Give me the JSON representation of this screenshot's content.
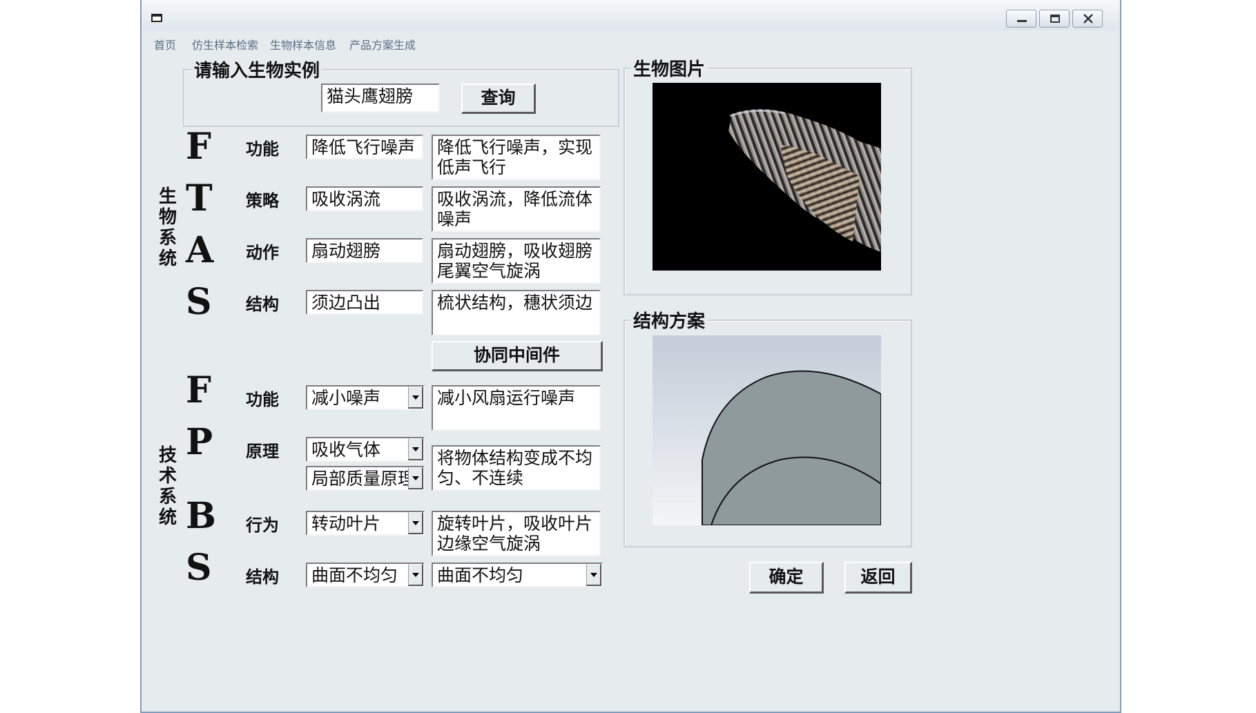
{
  "menu": {
    "items": [
      "首页",
      "仿生样本检索",
      "生物样本信息",
      "产品方案生成"
    ]
  },
  "search": {
    "legend": "请输入生物实例",
    "value": "猫头鹰翅膀",
    "button_label": "查询"
  },
  "bio": {
    "side_label": "生物系统",
    "rows": [
      {
        "letter": "F",
        "label": "功能",
        "value": "降低飞行噪声",
        "desc": "降低飞行噪声，实现低声飞行"
      },
      {
        "letter": "T",
        "label": "策略",
        "value": "吸收涡流",
        "desc": "吸收涡流，降低流体噪声"
      },
      {
        "letter": "A",
        "label": "动作",
        "value": "扇动翅膀",
        "desc": "扇动翅膀，吸收翅膀尾翼空气旋涡"
      },
      {
        "letter": "S",
        "label": "结构",
        "value": "须边凸出",
        "desc": "梳状结构，穗状须边"
      }
    ]
  },
  "middleware_button": "协同中间件",
  "tech": {
    "side_label": "技术系统",
    "rows": [
      {
        "letter": "F",
        "label": "功能",
        "value": "减小噪声",
        "desc": "减小风扇运行噪声"
      },
      {
        "letter": "P",
        "label": "原理",
        "value": "吸收气体",
        "value2": "局部质量原理",
        "desc": "将物体结构变成不均匀、不连续"
      },
      {
        "letter": "B",
        "label": "行为",
        "value": "转动叶片",
        "desc": "旋转叶片，吸收叶片边缘空气旋涡"
      },
      {
        "letter": "S",
        "label": "结构",
        "value": "曲面不均匀",
        "desc": "曲面不均匀"
      }
    ]
  },
  "panels": {
    "bio_image_legend": "生物图片",
    "structure_legend": "结构方案"
  },
  "footer": {
    "ok_label": "确定",
    "back_label": "返回"
  },
  "colors": {
    "window_bg": "#e6ebee",
    "menu_text": "#5a6d84",
    "photo_bg": "#000000",
    "structure_shape": "#8f9a9c"
  }
}
